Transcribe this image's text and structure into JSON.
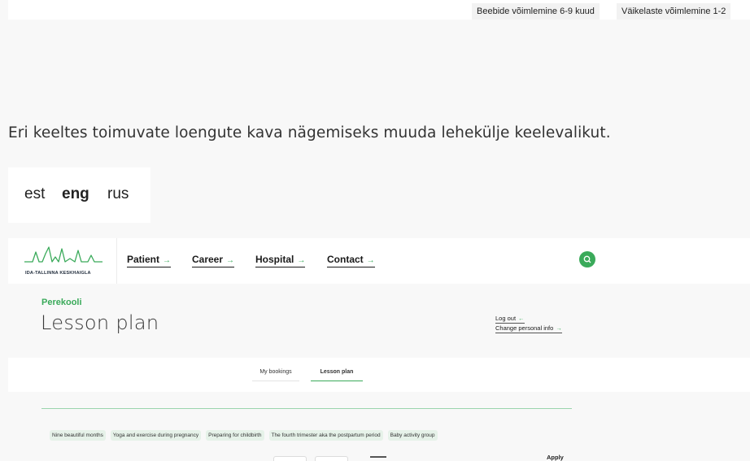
{
  "top_links": [
    "Beebide võimlemine 6-9 kuud",
    "Väikelaste võimlemine 1-2"
  ],
  "info_text": "Eri keeltes toimuvate loengute kava nägemiseks muuda lehekülje keelevalikut.",
  "languages": {
    "est": "est",
    "eng": "eng",
    "rus": "rus",
    "selected": "eng"
  },
  "header": {
    "logo_text": "IDA-TALLINNA KESKHAIGLA",
    "nav": [
      "Patient",
      "Career",
      "Hospital",
      "Contact"
    ],
    "search_icon": "search-icon"
  },
  "page": {
    "section_label": "Perekooli",
    "title": "Lesson plan",
    "account_links": [
      "Log out",
      "Change personal info"
    ]
  },
  "tabs": [
    "My bookings",
    "Lesson plan"
  ],
  "active_tab": "Lesson plan",
  "filters": [
    "Nine beautiful months",
    "Yoga and exercise during pregnancy",
    "Preparing for childbirth",
    "The fourth trimester aka the postpartum period",
    "Baby activity group"
  ],
  "apply_label": "Apply",
  "colors": {
    "accent": "#3aaa5a",
    "background": "#f8f8f8",
    "chip": "#e6f2e9"
  }
}
